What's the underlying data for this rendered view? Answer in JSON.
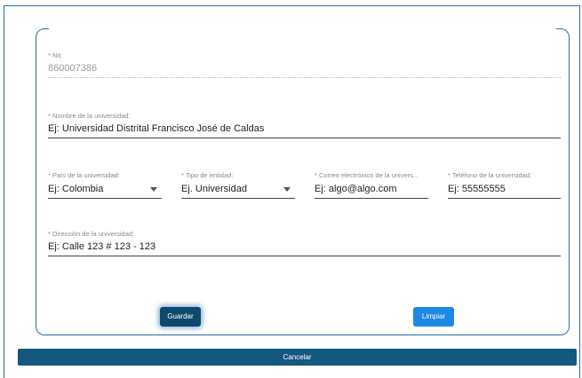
{
  "form": {
    "nit": {
      "label": "* Nit:",
      "value": "860007386"
    },
    "nombre": {
      "label": "* Nombre de la universidad:",
      "value": "Ej: Universidad Distrital Francisco José de Caldas"
    },
    "pais": {
      "label": "* País de la universidad:",
      "value": "Ej: Colombia"
    },
    "tipo": {
      "label": "* Tipo de entidad:",
      "value": "Ej. Universidad"
    },
    "correo": {
      "label": "* Correo electrónico de la univers...",
      "value": "Ej: algo@algo.com"
    },
    "telefono": {
      "label": "* Teléfono de la universidad:",
      "value": "Ej: 55555555"
    },
    "direccion": {
      "label": "* Dirección de la universidad:",
      "value": "Ej: Calle 123 # 123 - 123"
    }
  },
  "actions": {
    "guardar": "Guardar",
    "limpiar": "Limpiar",
    "cancelar": "Cancelar"
  },
  "colors": {
    "border": "#2f6fa8",
    "guardar_bg": "#0f4a6e",
    "limpiar_bg": "#1e88e5",
    "cancelar_bg": "#14577f"
  },
  "icons": {
    "dropdown": "chevron-down-icon"
  }
}
